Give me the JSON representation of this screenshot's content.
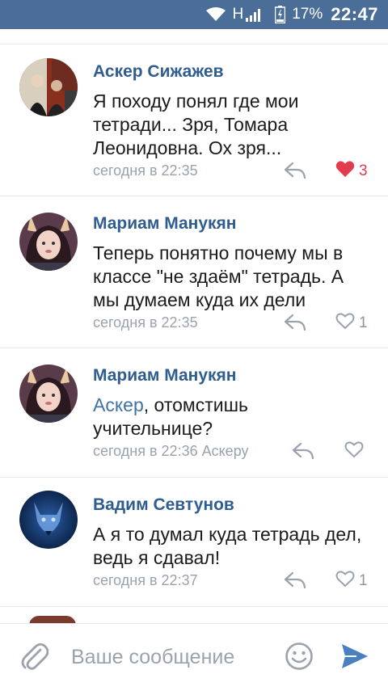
{
  "status_bar": {
    "network": "H",
    "battery": "17%",
    "time": "22:47"
  },
  "comments": [
    {
      "author": "Аскер Сижажев",
      "text": "Я походу понял где мои тетради... Зря, Томара Леонидовна. Ох зря...",
      "time": "сегодня в 22:35",
      "likes": "3",
      "liked": true,
      "avatar": "two-people-photo"
    },
    {
      "author": "Мариам Манукян",
      "text": "Теперь понятно почему мы в классе \"не здаём\" тетрадь. А мы думаем куда их дели",
      "time": "сегодня в 22:35",
      "likes": "1",
      "liked": false,
      "avatar": "girl-with-cat-ears-filter"
    },
    {
      "author": "Мариам Манукян",
      "mention": "Аскер",
      "text": ", отомстишь учительнице?",
      "time": "сегодня в 22:36 Аскеру",
      "likes": "",
      "liked": false,
      "avatar": "girl-with-cat-ears-filter"
    },
    {
      "author": "Вадим Севтунов",
      "text": "А я то думал куда тетрадь дел, ведь я сдавал!",
      "time": "сегодня в 22:37",
      "likes": "1",
      "liked": false,
      "avatar": "blue-wolf"
    }
  ],
  "composer": {
    "placeholder": "Ваше сообщение"
  },
  "colors": {
    "status_bar": "#4a6e97",
    "author": "#2f5d8f",
    "like_active": "#e33b4e",
    "meta": "#9aa3ad"
  }
}
